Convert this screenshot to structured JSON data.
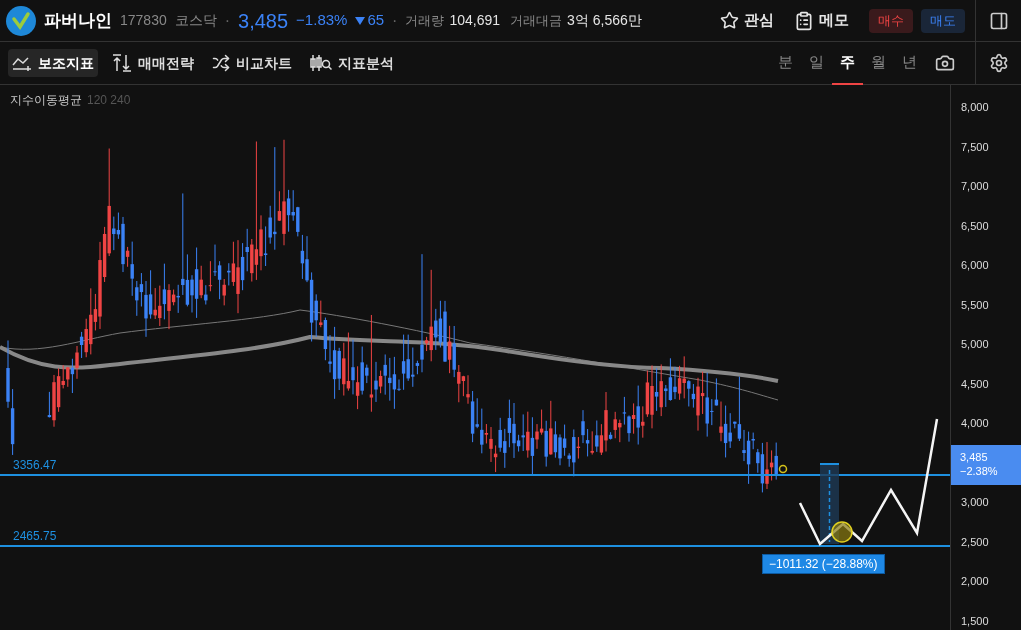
{
  "header": {
    "name": "파버나인",
    "code": "177830",
    "market": "코스닥",
    "separator": "·",
    "price": "3,485",
    "change_pct": "−1.83%",
    "change": "65",
    "volume_label": "거래량",
    "volume": "104,691",
    "amount_label": "거래대금",
    "amount": "3억 6,566만",
    "actions": [
      {
        "kind": "star",
        "label": "관심"
      },
      {
        "kind": "memo",
        "label": "메모"
      }
    ],
    "buy": "매수",
    "sell": "매도"
  },
  "toolbar": {
    "tools": [
      {
        "kind": "indicator",
        "label": "보조지표",
        "selected": true
      },
      {
        "kind": "strategy",
        "label": "매매전략",
        "selected": false
      },
      {
        "kind": "compare",
        "label": "비교차트",
        "selected": false
      },
      {
        "kind": "analysis",
        "label": "지표분석",
        "selected": false
      }
    ],
    "periods": [
      {
        "label": "분",
        "selected": false
      },
      {
        "label": "일",
        "selected": false
      },
      {
        "label": "주",
        "selected": true
      },
      {
        "label": "월",
        "selected": false
      },
      {
        "label": "년",
        "selected": false
      }
    ]
  },
  "chart": {
    "indicator": "지수이동평균",
    "indicator_params": "120 240",
    "yticks": [
      "8,000",
      "7,500",
      "7,000",
      "6,500",
      "6,000",
      "5,500",
      "5,000",
      "4,500",
      "4,000",
      "3,000",
      "2,500",
      "2,000",
      "1,500"
    ],
    "current_price": "3,485",
    "current_change": "−2.38%",
    "levels": [
      "3356.47",
      "2465.75"
    ],
    "measure": "−1011.32 (−28.88%)"
  }
}
